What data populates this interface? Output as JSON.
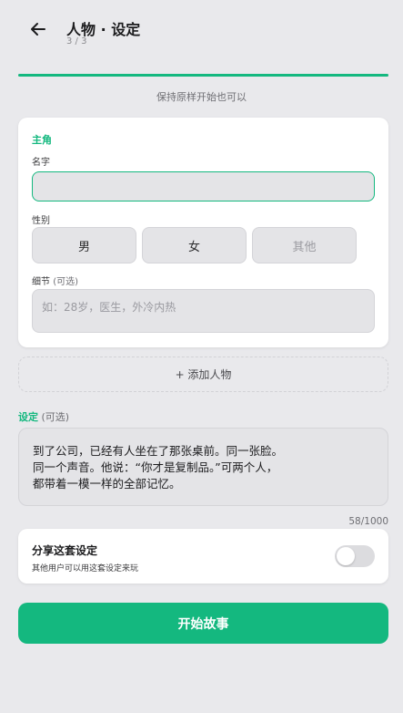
{
  "header": {
    "title": "人物 · 设定",
    "step": "3 / 3",
    "back_icon": "arrow-left-icon"
  },
  "progress": {
    "fraction": 1.0,
    "color": "#14b87f"
  },
  "hint": "保持原样开始也可以",
  "character": {
    "role_label": "主角",
    "name_label": "名字",
    "name_value": "",
    "gender_label": "性别",
    "gender_options": [
      "男",
      "女",
      "其他"
    ],
    "detail_label": "细节",
    "detail_optional": "(可选)",
    "detail_placeholder": "如：28岁，医生，外冷内热"
  },
  "add_person_label": "+ 添加人物",
  "setting": {
    "label": "设定",
    "optional": "(可选)",
    "text": "到了公司，已经有人坐在了那张桌前。同一张脸。\n同一个声音。他说：“你才是复制品。”可两个人，\n都带着一模一样的全部记忆。",
    "counter": "58/1000"
  },
  "share": {
    "title": "分享这套设定",
    "subtitle": "其他用户可以用这套设定来玩",
    "enabled": false
  },
  "start_button": "开始故事",
  "colors": {
    "accent": "#14b87f",
    "background": "#e9e9ec"
  }
}
